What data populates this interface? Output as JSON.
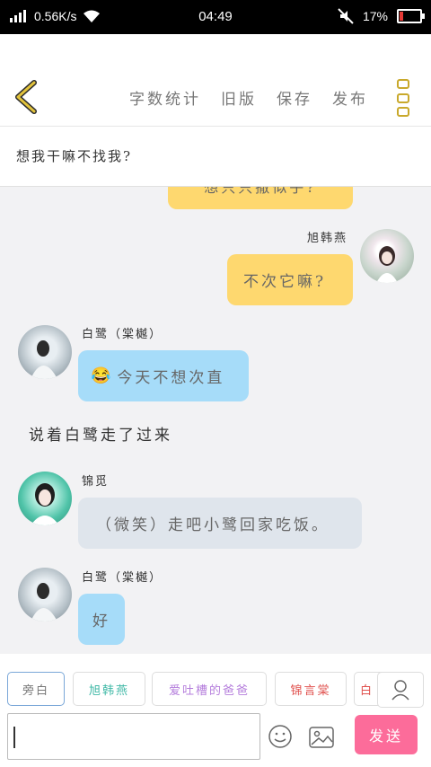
{
  "status": {
    "speed": "0.56K/s",
    "time": "04:49",
    "battery": "17%"
  },
  "header": {
    "actions": [
      "字数统计",
      "旧版",
      "保存",
      "发布"
    ]
  },
  "title": "想我干嘛不找我?",
  "messages": [
    {
      "side": "right",
      "name": "",
      "text": "想只只撒似乎?",
      "color": "yellow"
    },
    {
      "side": "right",
      "name": "旭韩燕",
      "text": "不次它嘛?",
      "color": "yellow"
    },
    {
      "side": "left",
      "name": "白鹭（棠樾）",
      "text": "今天不想次直",
      "emoji": "😂",
      "color": "blue"
    },
    {
      "side": "narration",
      "text": "说着白鹭走了过来"
    },
    {
      "side": "left",
      "name": "锦觅",
      "text": "（微笑）走吧小鹭回家吃饭。",
      "color": "gray"
    },
    {
      "side": "left",
      "name": "白鹭（棠樾）",
      "text": "好",
      "color": "blue"
    }
  ],
  "roles": [
    {
      "label": "旁白",
      "color": "#777777",
      "active": true
    },
    {
      "label": "旭韩燕",
      "color": "#3fb8a6"
    },
    {
      "label": "爱吐槽的爸爸",
      "color": "#b57edc"
    },
    {
      "label": "锦言棠",
      "color": "#e0504d"
    },
    {
      "label": "白",
      "color": "#e0504d"
    }
  ],
  "input": {
    "placeholder": "",
    "send_label": "发送"
  },
  "icons": {
    "back": "chevron-left-icon",
    "more": "more-vertical-icon",
    "emoji": "smile-icon",
    "image": "image-icon",
    "user": "user-icon"
  },
  "colors": {
    "accent": "#c9a92c",
    "yellow_bubble": "#fed86f",
    "blue_bubble": "#a6dcf9",
    "gray_bubble": "#dfe5ec",
    "send": "#fc6c9a"
  }
}
